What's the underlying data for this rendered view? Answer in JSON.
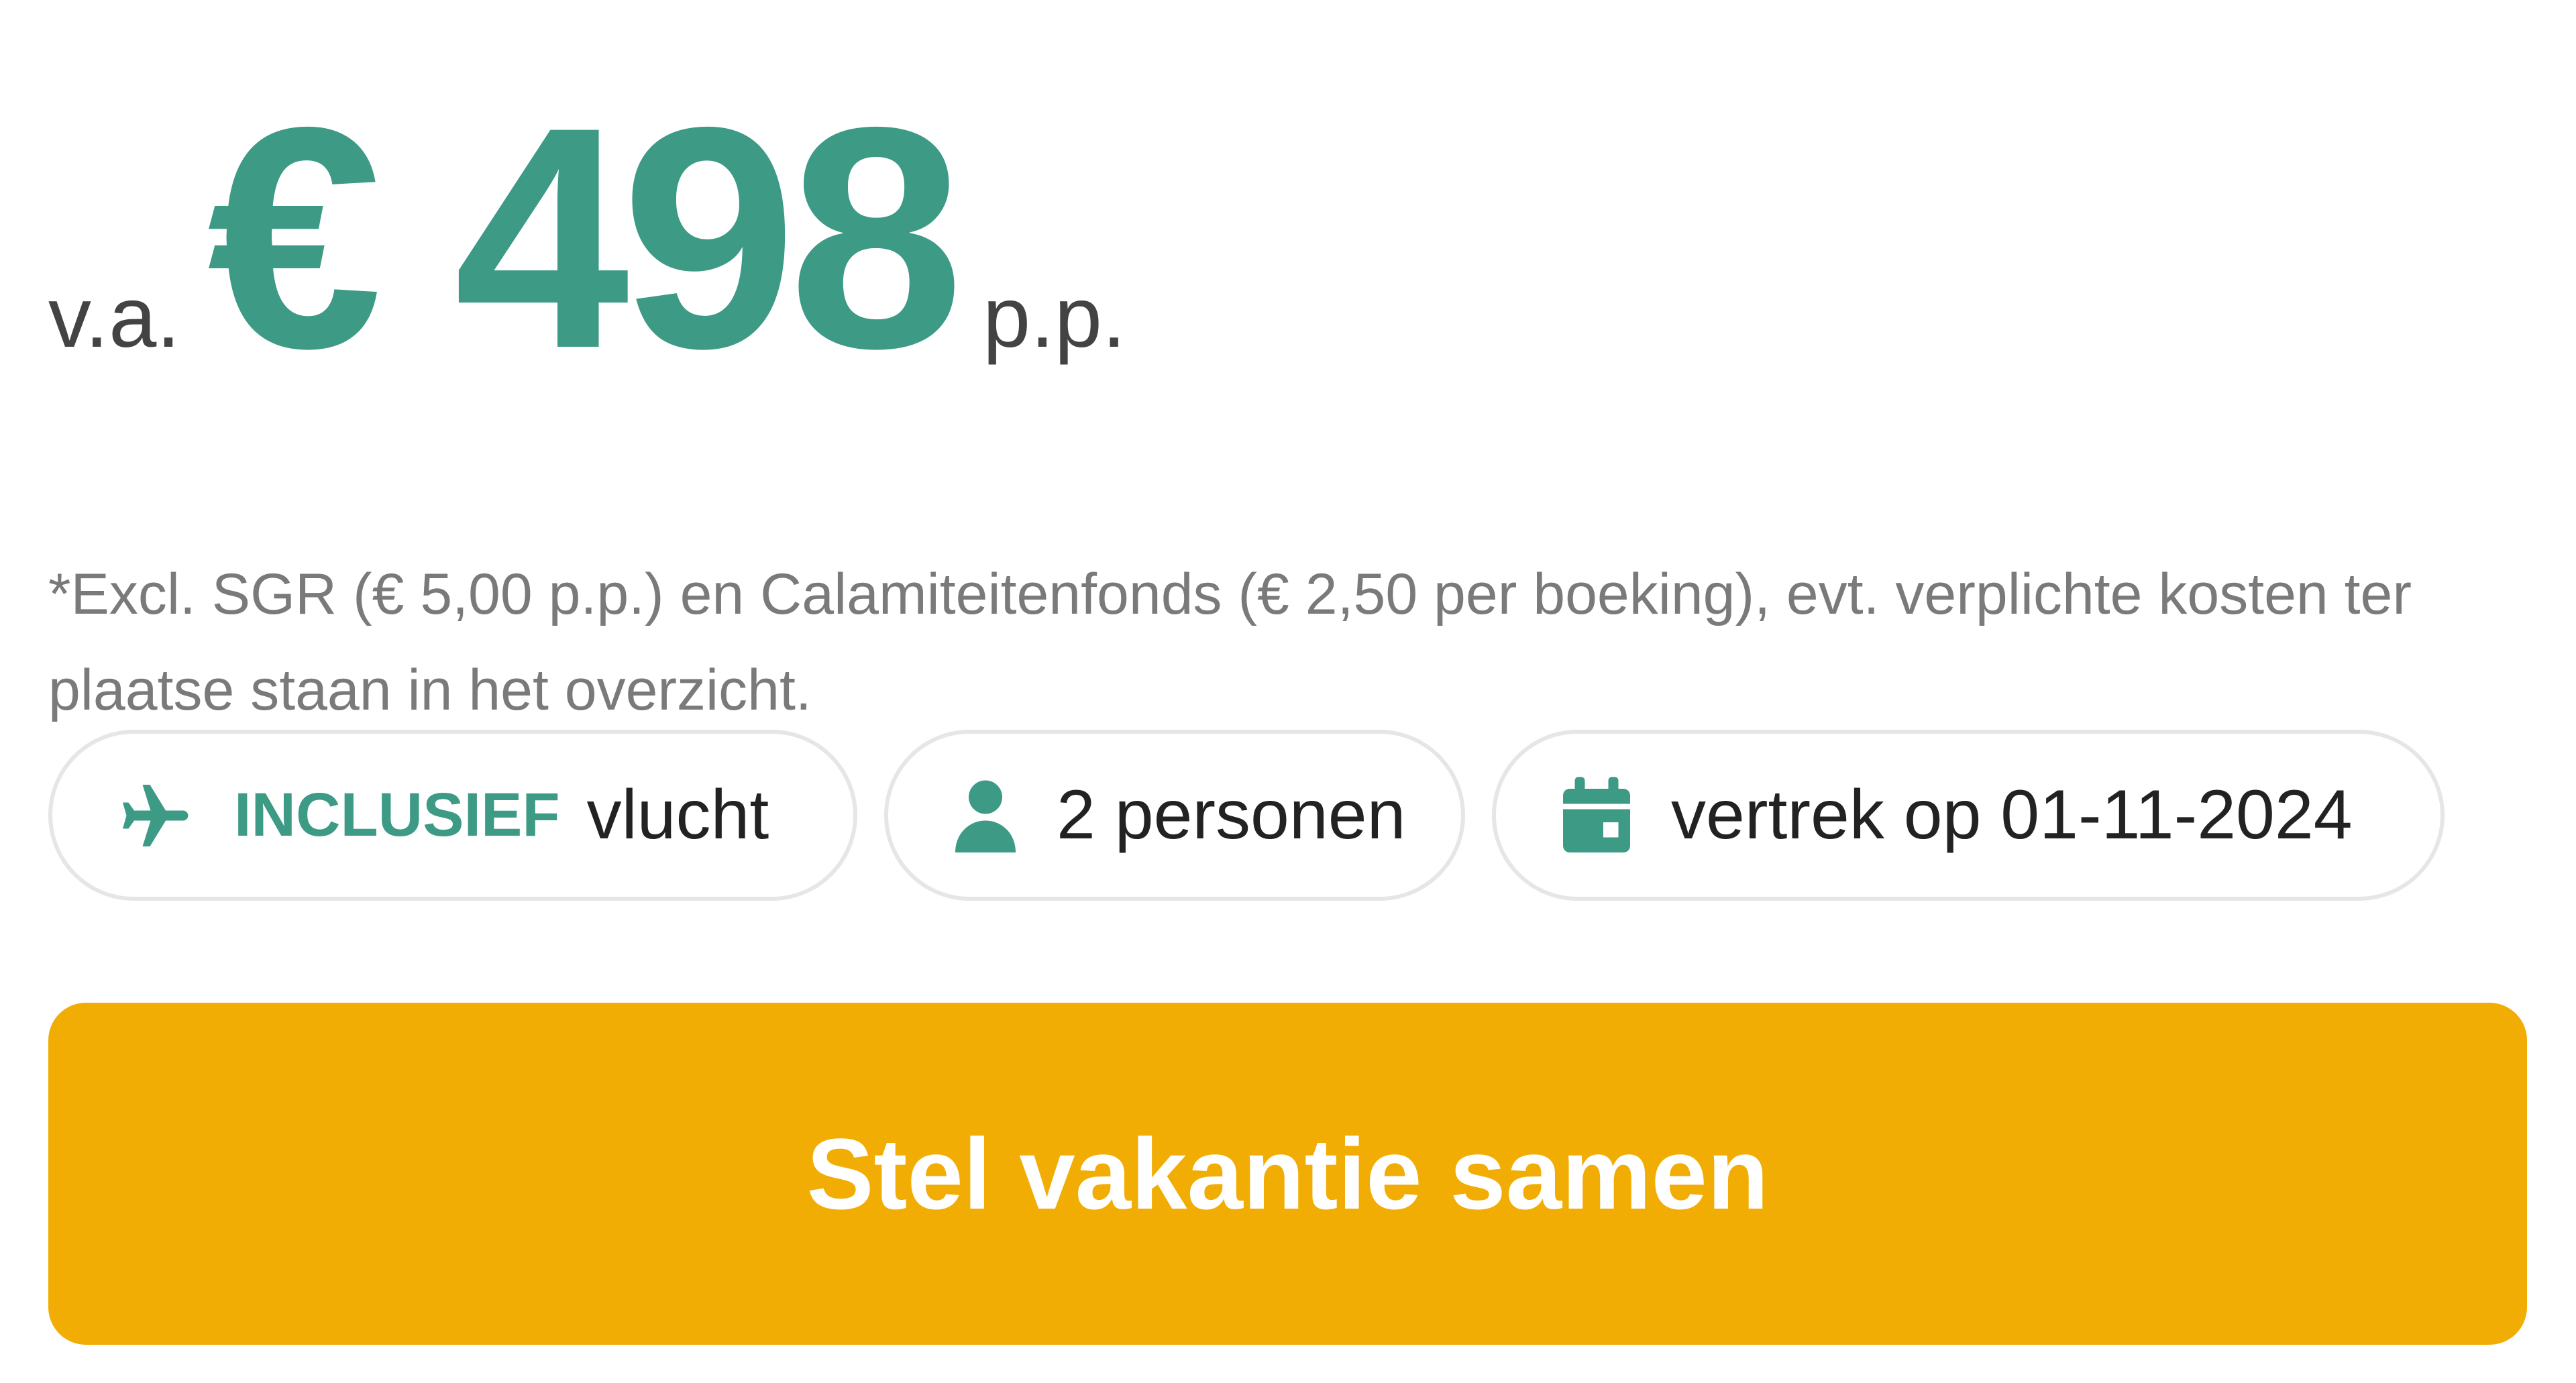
{
  "price": {
    "prefix": "v.a.",
    "amount": "€ 498",
    "suffix": "p.p."
  },
  "disclaimer": "*Excl. SGR (€ 5,00 p.p.) en Calamiteitenfonds (€ 2,50 per boeking), evt. verplichte kosten ter plaatse staan in het overzicht.",
  "chips": {
    "flight": {
      "icon": "airplane-icon",
      "emphasis": "INCLUSIEF",
      "label": "vlucht"
    },
    "persons": {
      "icon": "person-icon",
      "label": "2 personen"
    },
    "date": {
      "icon": "calendar-icon",
      "label": "vertrek op 01-11-2024"
    }
  },
  "cta": {
    "label": "Stel vakantie samen"
  },
  "colors": {
    "accent": "#3c9a85",
    "cta": "#f2ad04",
    "text": "#222222",
    "muted": "#7a7a7a",
    "chip_border": "#e6e6e6"
  }
}
